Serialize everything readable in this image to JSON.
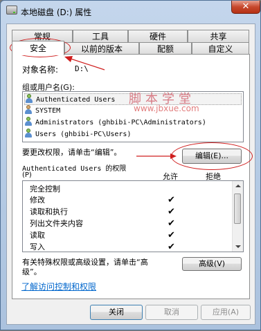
{
  "window": {
    "title": "本地磁盘 (D:) 属性",
    "close": "✕"
  },
  "tabs": {
    "row1": [
      "常规",
      "工具",
      "硬件",
      "共享"
    ],
    "row2": [
      "安全",
      "以前的版本",
      "配额",
      "自定义"
    ]
  },
  "object": {
    "label": "对象名称:",
    "value": "D:\\"
  },
  "groups": {
    "label": "组或用户名(G):",
    "users": [
      "Authenticated Users",
      "SYSTEM",
      "Administrators (ghbibi-PC\\Administrators)",
      "Users (ghbibi-PC\\Users)"
    ]
  },
  "edit": {
    "hint": "要更改权限，请单击“编辑”。",
    "button": "编辑(E)..."
  },
  "permissions": {
    "title": "Authenticated Users 的权限",
    "accel": "(P)",
    "allow": "允许",
    "deny": "拒绝",
    "items": [
      "完全控制",
      "修改",
      "读取和执行",
      "列出文件夹内容",
      "读取",
      "写入"
    ],
    "allowed": [
      false,
      true,
      true,
      true,
      true,
      true
    ],
    "check_glyph": "✔"
  },
  "special": {
    "hint_line1": "有关特殊权限或高级设置，请单击“高",
    "hint_line2": "级”。",
    "button": "高级(V)"
  },
  "link": "了解访问控制和权限",
  "footer": {
    "close": "关闭",
    "cancel": "取消",
    "apply": "应用(A)"
  },
  "watermark": {
    "line1": "脚本学堂",
    "line2": "www.jbxue.com"
  },
  "annotation_color": "#cf1d1d"
}
